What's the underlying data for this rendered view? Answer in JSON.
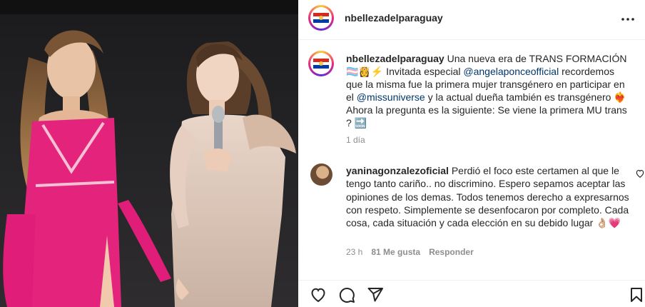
{
  "post": {
    "username": "nbellezadelparaguay",
    "caption_username": "nbellezadelparaguay",
    "caption_parts": {
      "p1": "Una nueva era de TRANS FORMACIÓN 🏳️‍⚧️👸⚡ Invitada especial ",
      "mention1": "@angelaponceofficial",
      "p2": " recordemos que la misma fue la primera mujer transgénero en participar en el ",
      "mention2": "@missuniverse",
      "p3": " y la actual dueña también es transgénero ❤️‍🔥 Ahora la pregunta es la siguiente: Se viene la primera MU trans ? 🔜"
    },
    "time": "1 día"
  },
  "comment": {
    "username": "yaninagonzalezoficial",
    "text": "Perdió el foco este certamen al que le tengo tanto cariño.. no discrimino. Espero sepamos aceptar las opiniones de los demas. Todos tenemos derecho a expresarnos con respeto. Simplemente se desenfocaron por completo. Cada cosa, cada situación y cada elección en su debido lugar 👌🏼💗",
    "time": "23 h",
    "likes": "81 Me gusta",
    "reply": "Responder"
  },
  "icons": {
    "more": "more-options-icon",
    "like": "heart-icon",
    "comment": "comment-icon",
    "share": "send-icon",
    "save": "bookmark-icon"
  },
  "colors": {
    "mention": "#00376b",
    "secondary": "#8e8e8e",
    "border": "#efefef"
  }
}
